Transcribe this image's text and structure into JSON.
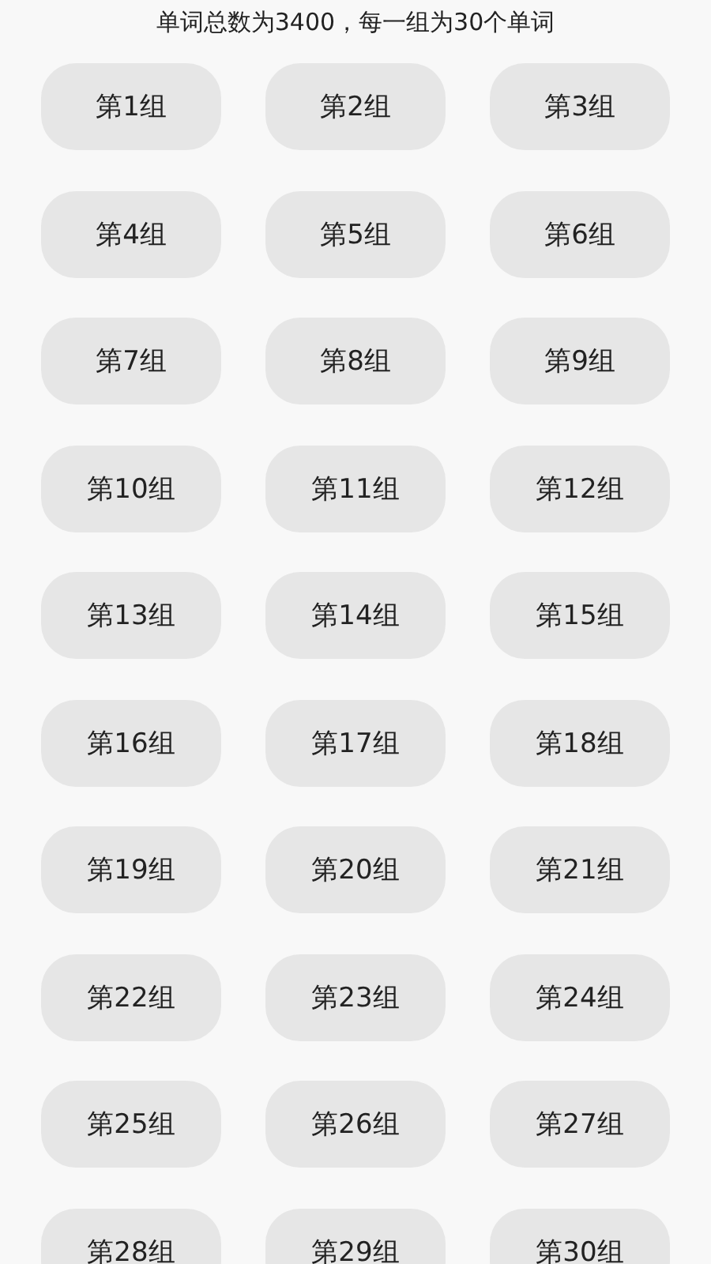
{
  "header": "单词总数为3400，每一组为30个单词",
  "groups": [
    "第1组",
    "第2组",
    "第3组",
    "第4组",
    "第5组",
    "第6组",
    "第7组",
    "第8组",
    "第9组",
    "第10组",
    "第11组",
    "第12组",
    "第13组",
    "第14组",
    "第15组",
    "第16组",
    "第17组",
    "第18组",
    "第19组",
    "第20组",
    "第21组",
    "第22组",
    "第23组",
    "第24组",
    "第25组",
    "第26组",
    "第27组",
    "第28组",
    "第29组",
    "第30组"
  ]
}
